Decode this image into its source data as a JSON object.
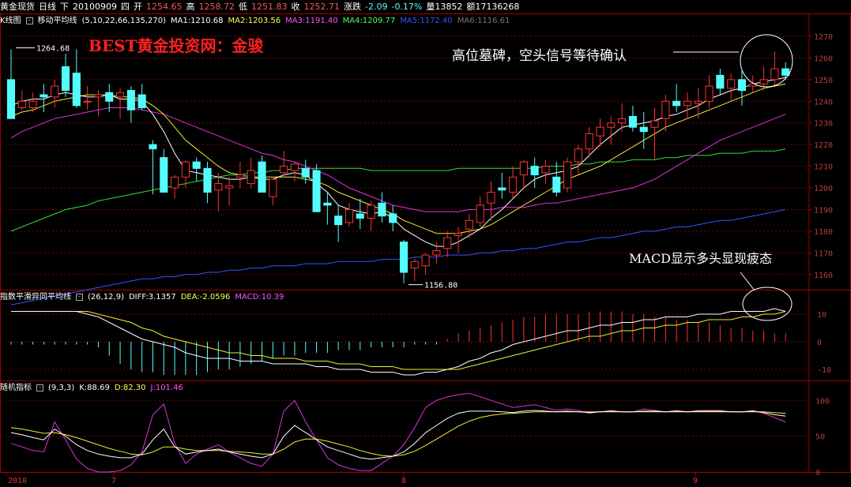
{
  "topbar": {
    "items": [
      {
        "text": "黄金现货",
        "color": "#ffffff"
      },
      {
        "text": "日线",
        "color": "#ffffff"
      },
      {
        "text": "下",
        "color": "#ffffff"
      },
      {
        "text": "20100909",
        "color": "#ffffff"
      },
      {
        "text": "四",
        "color": "#ffffff"
      },
      {
        "text": "开",
        "color": "#ffffff"
      },
      {
        "text": "1254.65",
        "color": "#ff5555"
      },
      {
        "text": "高",
        "color": "#ffffff"
      },
      {
        "text": "1258.72",
        "color": "#ff5555"
      },
      {
        "text": "低",
        "color": "#ffffff"
      },
      {
        "text": "1251.83",
        "color": "#ff5555"
      },
      {
        "text": "收",
        "color": "#ffffff"
      },
      {
        "text": "1252.71",
        "color": "#ff5555"
      },
      {
        "text": "涨跌",
        "color": "#ffffff"
      },
      {
        "text": "-2.09",
        "color": "#55ffff"
      },
      {
        "text": "-0.17%",
        "color": "#55ffff"
      },
      {
        "text": "量13852",
        "color": "#ffffff"
      },
      {
        "text": "额17136268",
        "color": "#ffffff"
      }
    ]
  },
  "main_head": {
    "title": "K线图",
    "btn": "-",
    "indicator": "移动平均线",
    "params": "(5,10,22,66,135,270)",
    "ma": [
      {
        "label": "MA1:1210.68",
        "color": "#ffffff"
      },
      {
        "label": "MA2:1203.56",
        "color": "#ffff55"
      },
      {
        "label": "MA3:1191.40",
        "color": "#ff55ff"
      },
      {
        "label": "MA4:1209.77",
        "color": "#55ff55"
      },
      {
        "label": "MA5:1172.40",
        "color": "#3355ff"
      },
      {
        "label": "MA6:1116.61",
        "color": "#777777"
      }
    ]
  },
  "watermark": "BEST黄金投资网：金骏",
  "annotations": {
    "top": "高位墓碑，空头信号等待确认",
    "macd": "MACD显示多头显现疲态"
  },
  "price_labels": {
    "high": "1264.68",
    "low": "1156.80"
  },
  "macd_head": {
    "btn": "-",
    "title": "指数平滑异同平均线",
    "params": "(26,12,9)",
    "diff": "DIFF:3.1357",
    "dea": "DEA:-2.0596",
    "macd": "MACD:10.39"
  },
  "kdj_head": {
    "btn": "-",
    "title": "随机指标",
    "params": "(9,3,3)",
    "k": "K:88.69",
    "d": "D:82.30",
    "j": "J:101.46"
  },
  "x_labels": [
    "2010",
    "7",
    "8",
    "9"
  ],
  "colors": {
    "up": "#ff3232",
    "down": "#54fcfc",
    "grid": "#800000",
    "axis": "#a00000",
    "text": "#ffffff",
    "wm": "#ff2020"
  },
  "chart_data": {
    "type": "candlestick",
    "price_ticks": [
      1160,
      1170,
      1180,
      1190,
      1200,
      1210,
      1220,
      1230,
      1240,
      1250,
      1260,
      1270
    ],
    "macd_ticks": [
      10,
      0,
      -10
    ],
    "kdj_ticks": [
      100,
      50,
      0
    ],
    "candles": [
      [
        1250,
        1264,
        1232,
        1232
      ],
      [
        1237,
        1245,
        1236,
        1240
      ],
      [
        1237,
        1244,
        1235,
        1240
      ],
      [
        1243,
        1248,
        1235,
        1242
      ],
      [
        1242,
        1250,
        1237,
        1247
      ],
      [
        1256,
        1262,
        1242,
        1245
      ],
      [
        1253,
        1264,
        1237,
        1238
      ],
      [
        1240,
        1247,
        1236,
        1240
      ],
      [
        1242,
        1245,
        1233,
        1243
      ],
      [
        1244,
        1248,
        1235,
        1240
      ],
      [
        1242,
        1246,
        1232,
        1244
      ],
      [
        1245,
        1247,
        1230,
        1236
      ],
      [
        1243,
        1248,
        1236,
        1237
      ],
      [
        1220,
        1222,
        1197,
        1218
      ],
      [
        1214,
        1218,
        1200,
        1198
      ],
      [
        1200,
        1206,
        1195,
        1205
      ],
      [
        1205,
        1213,
        1200,
        1212
      ],
      [
        1212,
        1214,
        1203,
        1209
      ],
      [
        1209,
        1212,
        1193,
        1198
      ],
      [
        1199,
        1207,
        1189,
        1202
      ],
      [
        1200,
        1205,
        1192,
        1201
      ],
      [
        1205,
        1212,
        1200,
        1206
      ],
      [
        1202,
        1214,
        1200,
        1208
      ],
      [
        1212,
        1215,
        1200,
        1198
      ],
      [
        1196,
        1205,
        1192,
        1204
      ],
      [
        1207,
        1217,
        1205,
        1210
      ],
      [
        1208,
        1212,
        1203,
        1211
      ],
      [
        1209,
        1213,
        1202,
        1205
      ],
      [
        1208,
        1211,
        1190,
        1189
      ],
      [
        1193,
        1198,
        1183,
        1192
      ],
      [
        1187,
        1192,
        1175,
        1183
      ],
      [
        1184,
        1193,
        1182,
        1190
      ],
      [
        1188,
        1195,
        1181,
        1186
      ],
      [
        1186,
        1194,
        1180,
        1192
      ],
      [
        1193,
        1198,
        1184,
        1187
      ],
      [
        1188,
        1192,
        1180,
        1184
      ],
      [
        1175,
        1176,
        1156,
        1161
      ],
      [
        1163,
        1167,
        1157,
        1166
      ],
      [
        1164,
        1170,
        1160,
        1169
      ],
      [
        1169,
        1175,
        1165,
        1171
      ],
      [
        1172,
        1180,
        1168,
        1177
      ],
      [
        1178,
        1182,
        1170,
        1179
      ],
      [
        1181,
        1188,
        1177,
        1185
      ],
      [
        1184,
        1196,
        1182,
        1192
      ],
      [
        1193,
        1203,
        1185,
        1198
      ],
      [
        1200,
        1207,
        1195,
        1199
      ],
      [
        1198,
        1210,
        1195,
        1205
      ],
      [
        1206,
        1213,
        1200,
        1212
      ],
      [
        1210,
        1214,
        1200,
        1206
      ],
      [
        1207,
        1213,
        1202,
        1210
      ],
      [
        1205,
        1212,
        1196,
        1198
      ],
      [
        1200,
        1214,
        1198,
        1212
      ],
      [
        1212,
        1220,
        1206,
        1218
      ],
      [
        1218,
        1228,
        1214,
        1225
      ],
      [
        1224,
        1232,
        1219,
        1228
      ],
      [
        1228,
        1233,
        1220,
        1230
      ],
      [
        1230,
        1239,
        1226,
        1232
      ],
      [
        1233,
        1238,
        1226,
        1228
      ],
      [
        1228,
        1235,
        1218,
        1226
      ],
      [
        1228,
        1237,
        1213,
        1231
      ],
      [
        1232,
        1243,
        1226,
        1240
      ],
      [
        1240,
        1248,
        1235,
        1238
      ],
      [
        1238,
        1244,
        1232,
        1240
      ],
      [
        1239,
        1246,
        1232,
        1240
      ],
      [
        1240,
        1252,
        1237,
        1247
      ],
      [
        1252,
        1255,
        1243,
        1246
      ],
      [
        1246,
        1253,
        1240,
        1250
      ],
      [
        1250,
        1254,
        1238,
        1245
      ],
      [
        1247,
        1252,
        1244,
        1248
      ],
      [
        1248,
        1256,
        1245,
        1250
      ],
      [
        1250,
        1263,
        1247,
        1255
      ],
      [
        1255,
        1258,
        1250,
        1252
      ]
    ],
    "ma1": [
      1238,
      1240,
      1241,
      1241,
      1243,
      1244,
      1243,
      1242,
      1242,
      1243,
      1241,
      1241,
      1240,
      1234,
      1226,
      1216,
      1208,
      1207,
      1206,
      1205,
      1204,
      1204,
      1205,
      1204,
      1204,
      1206,
      1207,
      1206,
      1202,
      1198,
      1192,
      1190,
      1189,
      1188,
      1189,
      1186,
      1181,
      1178,
      1175,
      1173,
      1173,
      1175,
      1178,
      1181,
      1186,
      1190,
      1195,
      1200,
      1204,
      1206,
      1207,
      1208,
      1210,
      1215,
      1220,
      1224,
      1228,
      1229,
      1230,
      1231,
      1233,
      1234,
      1236,
      1238,
      1241,
      1243,
      1245,
      1246,
      1248,
      1249,
      1250,
      1251
    ],
    "ma2": [
      1233,
      1235,
      1236,
      1238,
      1240,
      1241,
      1242,
      1243,
      1243,
      1243,
      1242,
      1242,
      1241,
      1238,
      1234,
      1228,
      1222,
      1218,
      1214,
      1210,
      1207,
      1206,
      1205,
      1205,
      1205,
      1205,
      1205,
      1204,
      1203,
      1201,
      1198,
      1196,
      1194,
      1192,
      1190,
      1188,
      1185,
      1183,
      1181,
      1179,
      1179,
      1179,
      1180,
      1181,
      1183,
      1186,
      1189,
      1192,
      1195,
      1198,
      1201,
      1204,
      1206,
      1208,
      1210,
      1213,
      1216,
      1219,
      1222,
      1225,
      1228,
      1230,
      1232,
      1234,
      1236,
      1238,
      1240,
      1242,
      1244,
      1246,
      1247,
      1248
    ],
    "ma3": [
      1223,
      1226,
      1228,
      1230,
      1232,
      1233,
      1234,
      1235,
      1236,
      1237,
      1237,
      1237,
      1236,
      1235,
      1234,
      1232,
      1230,
      1228,
      1226,
      1224,
      1222,
      1220,
      1218,
      1216,
      1215,
      1213,
      1212,
      1210,
      1208,
      1206,
      1203,
      1200,
      1198,
      1196,
      1194,
      1192,
      1191,
      1190,
      1189,
      1189,
      1189,
      1189,
      1190,
      1190,
      1190,
      1191,
      1191,
      1191,
      1192,
      1193,
      1193,
      1194,
      1195,
      1196,
      1197,
      1198,
      1199,
      1200,
      1202,
      1204,
      1207,
      1210,
      1213,
      1216,
      1219,
      1222,
      1224,
      1226,
      1228,
      1230,
      1232,
      1234
    ],
    "ma4": [
      1180,
      1182,
      1184,
      1186,
      1188,
      1190,
      1191,
      1192,
      1194,
      1195,
      1196,
      1197,
      1198,
      1199,
      1200,
      1201,
      1202,
      1203,
      1204,
      1205,
      1206,
      1206,
      1207,
      1207,
      1208,
      1208,
      1209,
      1209,
      1209,
      1209,
      1209,
      1209,
      1209,
      1208,
      1208,
      1208,
      1208,
      1208,
      1208,
      1208,
      1208,
      1209,
      1209,
      1209,
      1209,
      1209,
      1209,
      1209,
      1209,
      1210,
      1210,
      1210,
      1211,
      1211,
      1212,
      1212,
      1212,
      1213,
      1213,
      1213,
      1214,
      1214,
      1215,
      1215,
      1215,
      1216,
      1216,
      1216,
      1217,
      1217,
      1217,
      1218
    ],
    "ma5": [
      1146,
      1147,
      1148,
      1149,
      1150,
      1151,
      1152,
      1153,
      1154,
      1155,
      1156,
      1157,
      1158,
      1158,
      1159,
      1159,
      1160,
      1160,
      1161,
      1161,
      1162,
      1162,
      1163,
      1163,
      1164,
      1164,
      1164,
      1165,
      1165,
      1165,
      1166,
      1166,
      1166,
      1166,
      1167,
      1167,
      1167,
      1168,
      1168,
      1168,
      1169,
      1169,
      1169,
      1170,
      1170,
      1171,
      1171,
      1172,
      1172,
      1173,
      1174,
      1175,
      1175,
      1176,
      1177,
      1177,
      1178,
      1179,
      1180,
      1180,
      1181,
      1182,
      1182,
      1183,
      1184,
      1185,
      1185,
      1186,
      1187,
      1188,
      1189,
      1190
    ],
    "macd_bars": [
      -1,
      -1,
      -1,
      -1,
      -1,
      -1,
      -1,
      -1,
      -2,
      -5,
      -8,
      -10,
      -11,
      -11,
      -12,
      -12,
      -12,
      -12,
      -11,
      -10,
      -10,
      -9,
      -8,
      -7,
      -6,
      -5,
      -5,
      -4,
      -4,
      -4,
      -3,
      -3,
      -3,
      -2,
      -2,
      -2,
      -2,
      -1,
      -1,
      -1,
      1,
      3,
      4,
      5,
      6,
      7,
      8,
      9,
      9,
      10,
      10,
      10,
      10,
      11,
      11,
      11,
      11,
      10,
      10,
      9,
      9,
      8,
      8,
      7,
      7,
      6,
      5,
      5,
      4,
      4,
      3,
      3
    ],
    "diff": [
      11,
      11,
      11,
      11,
      11,
      11,
      11,
      10,
      9,
      7,
      5,
      3,
      1,
      0,
      -1,
      -2,
      -4,
      -5,
      -6,
      -6,
      -6,
      -7,
      -7,
      -7,
      -8,
      -8,
      -8,
      -8,
      -9,
      -9,
      -10,
      -10,
      -10,
      -11,
      -11,
      -11,
      -12,
      -12,
      -11,
      -11,
      -10,
      -9,
      -7,
      -6,
      -4,
      -3,
      -1,
      0,
      1,
      2,
      3,
      4,
      4,
      5,
      6,
      6,
      7,
      7,
      8,
      8,
      9,
      9,
      9,
      10,
      10,
      10,
      11,
      11,
      11,
      11,
      12,
      11
    ],
    "dea": [
      11,
      11,
      11,
      11,
      11,
      11,
      11,
      11,
      10,
      9,
      8,
      7,
      5,
      4,
      2,
      1,
      0,
      -1,
      -2,
      -3,
      -4,
      -4,
      -5,
      -5,
      -6,
      -6,
      -6,
      -7,
      -7,
      -7,
      -8,
      -8,
      -8,
      -9,
      -9,
      -9,
      -10,
      -10,
      -10,
      -10,
      -10,
      -10,
      -9,
      -8,
      -7,
      -6,
      -5,
      -4,
      -3,
      -2,
      -1,
      0,
      1,
      2,
      2,
      3,
      4,
      4,
      5,
      5,
      6,
      6,
      7,
      7,
      8,
      8,
      8,
      9,
      9,
      10,
      10,
      11
    ],
    "k": [
      55,
      52,
      48,
      45,
      60,
      50,
      38,
      30,
      25,
      22,
      20,
      20,
      25,
      45,
      60,
      35,
      25,
      28,
      30,
      32,
      28,
      25,
      22,
      20,
      25,
      50,
      65,
      55,
      45,
      35,
      30,
      25,
      20,
      18,
      20,
      22,
      28,
      40,
      55,
      65,
      75,
      82,
      85,
      85,
      85,
      84,
      83,
      85,
      86,
      85,
      84,
      85,
      84,
      83,
      84,
      85,
      84,
      84,
      85,
      85,
      84,
      85,
      84,
      85,
      85,
      85,
      84,
      84,
      85,
      83,
      80,
      78
    ],
    "d": [
      62,
      60,
      57,
      54,
      55,
      52,
      48,
      43,
      38,
      33,
      29,
      25,
      24,
      28,
      35,
      35,
      32,
      30,
      30,
      30,
      29,
      28,
      27,
      25,
      25,
      32,
      42,
      46,
      46,
      43,
      39,
      35,
      30,
      26,
      23,
      22,
      24,
      29,
      37,
      46,
      55,
      64,
      71,
      76,
      79,
      81,
      82,
      83,
      84,
      84,
      84,
      84,
      84,
      84,
      84,
      84,
      84,
      84,
      84,
      84,
      84,
      84,
      84,
      84,
      84,
      84,
      84,
      84,
      84,
      84,
      83,
      82
    ],
    "j": [
      40,
      35,
      30,
      28,
      70,
      45,
      18,
      5,
      0,
      0,
      2,
      10,
      28,
      80,
      95,
      40,
      12,
      25,
      32,
      38,
      28,
      20,
      12,
      8,
      25,
      85,
      100,
      70,
      45,
      20,
      10,
      5,
      2,
      2,
      12,
      22,
      38,
      62,
      90,
      100,
      105,
      108,
      110,
      105,
      100,
      95,
      90,
      92,
      94,
      90,
      86,
      88,
      86,
      82,
      84,
      86,
      84,
      84,
      88,
      86,
      84,
      86,
      84,
      86,
      86,
      86,
      84,
      84,
      86,
      82,
      76,
      70
    ]
  }
}
